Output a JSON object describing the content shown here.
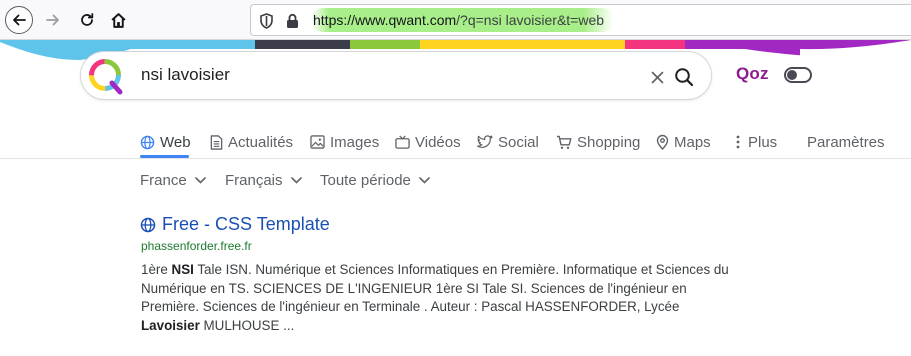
{
  "browser": {
    "url_host": "https://www.qwant.com",
    "url_path": "/?q=nsi lavoisier&t=web"
  },
  "search": {
    "query": "nsi lavoisier"
  },
  "qoz": {
    "label": "Qoz"
  },
  "tabs": [
    {
      "label": "Web",
      "icon": "globe-icon",
      "active": true
    },
    {
      "label": "Actualités",
      "icon": "news-icon"
    },
    {
      "label": "Images",
      "icon": "image-icon"
    },
    {
      "label": "Vidéos",
      "icon": "tv-icon"
    },
    {
      "label": "Social",
      "icon": "bird-icon"
    },
    {
      "label": "Shopping",
      "icon": "cart-icon"
    },
    {
      "label": "Maps",
      "icon": "map-pin-icon"
    },
    {
      "label": "Plus",
      "icon": "more-vertical-icon"
    },
    {
      "label": "Paramètres"
    }
  ],
  "filters": [
    {
      "label": "France"
    },
    {
      "label": "Français"
    },
    {
      "label": "Toute période"
    }
  ],
  "result": {
    "title": "Free - CSS Template",
    "url": "phassenforder.free.fr",
    "snippet": {
      "part1": "1ère ",
      "bold1": "NSI",
      "part2": " Tale ISN. Numérique et Sciences Informatiques en Première. Informatique et Sciences du Numérique en TS. SCIENCES DE L'INGENIEUR 1ère SI Tale SI. Sciences de l'ingénieur en Première. Sciences de l'ingénieur en Terminale . Auteur : Pascal HASSENFORDER, Lycée ",
      "bold2": "Lavoisier",
      "part3": " MULHOUSE ..."
    }
  },
  "colors": {
    "accent": "#4084f4",
    "link": "#1a4fb4",
    "url_green": "#1d7a2e",
    "qoz_purple": "#8a1c8d"
  }
}
